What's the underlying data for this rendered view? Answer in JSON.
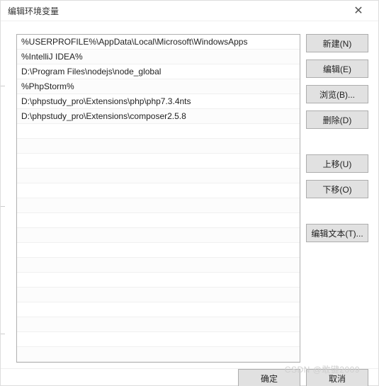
{
  "titlebar": {
    "title": "编辑环境变量"
  },
  "list": {
    "items": [
      "%USERPROFILE%\\AppData\\Local\\Microsoft\\WindowsApps",
      "%IntelliJ IDEA%",
      "D:\\Program Files\\nodejs\\node_global",
      "%PhpStorm%",
      "D:\\phpstudy_pro\\Extensions\\php\\php7.3.4nts",
      "D:\\phpstudy_pro\\Extensions\\composer2.5.8"
    ]
  },
  "buttons": {
    "new": "新建(N)",
    "edit": "编辑(E)",
    "browse": "浏览(B)...",
    "delete": "删除(D)",
    "moveup": "上移(U)",
    "movedown": "下移(O)",
    "edittext": "编辑文本(T)...",
    "ok": "确定",
    "cancel": "取消"
  },
  "watermark": "CSDN @敢键2009"
}
